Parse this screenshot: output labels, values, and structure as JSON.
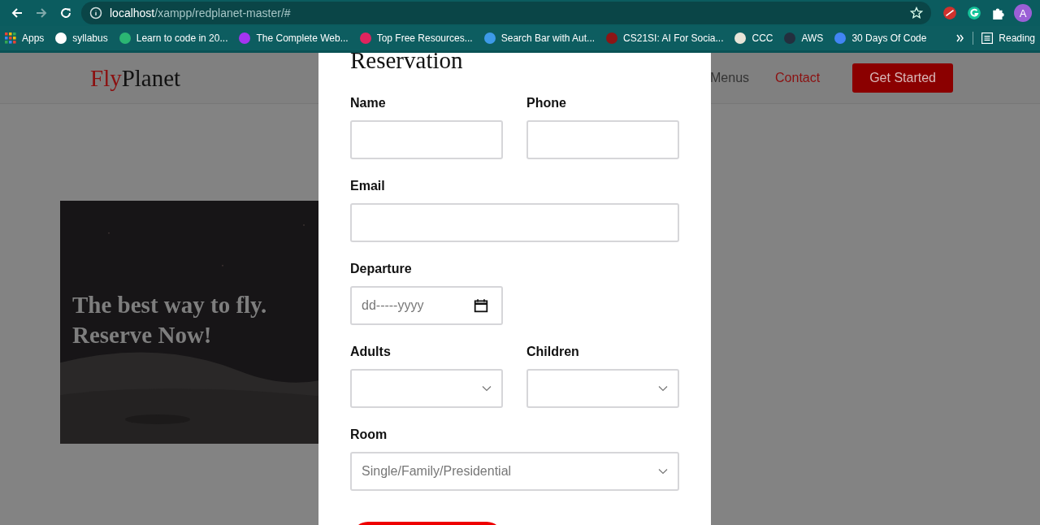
{
  "browser": {
    "url": {
      "host": "localhost",
      "path": "/xampp/redplanet-master/#"
    },
    "profile": "A",
    "bookmarks": [
      {
        "kind": "apps",
        "label": "Apps"
      },
      {
        "kind": "site",
        "label": "syllabus",
        "color": "#ffffff"
      },
      {
        "kind": "site",
        "label": "Learn to code in 20...",
        "color": "#2bb673"
      },
      {
        "kind": "site",
        "label": "The Complete Web...",
        "color": "#a435f0"
      },
      {
        "kind": "site",
        "label": "Top Free Resources...",
        "color": "#e0245e"
      },
      {
        "kind": "site",
        "label": "Search Bar with Aut...",
        "color": "#3d9ae8"
      },
      {
        "kind": "site",
        "label": "CS21SI: AI For Socia...",
        "color": "#8c1515"
      },
      {
        "kind": "site",
        "label": "CCC",
        "color": "#e8e4d8"
      },
      {
        "kind": "site",
        "label": "AWS",
        "color": "#232f3e"
      },
      {
        "kind": "site",
        "label": "30 Days Of Code",
        "color": "#4285f4"
      }
    ],
    "reading_list": "Reading"
  },
  "site": {
    "logo": {
      "first": "Fly",
      "second": "Planet"
    },
    "nav": [
      {
        "label": "Menus",
        "selected": false
      },
      {
        "label": "Contact",
        "selected": true
      }
    ],
    "cta": "Get Started",
    "hero": {
      "kind": "picture",
      "lines": [
        "The best way to fly.",
        "Reserve Now!"
      ]
    }
  },
  "modal": {
    "title": "Reservation",
    "rows": [
      [
        {
          "kind": "text",
          "label": "Name"
        },
        {
          "kind": "text",
          "label": "Phone"
        }
      ],
      [
        {
          "kind": "text",
          "label": "Email"
        }
      ],
      [
        {
          "kind": "date",
          "label": "Departure",
          "placeholder": "dd-----yyyy"
        }
      ],
      [
        {
          "kind": "select",
          "label": "Adults"
        },
        {
          "kind": "select",
          "label": "Children"
        }
      ],
      [
        {
          "kind": "select",
          "label": "Room",
          "placeholder": "Single/Family/Presidential"
        }
      ]
    ]
  }
}
